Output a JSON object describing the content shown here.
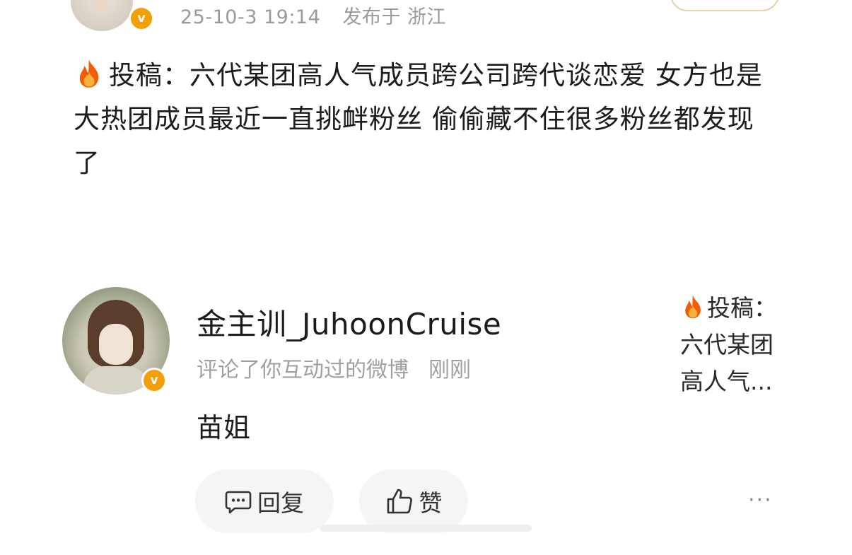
{
  "post": {
    "date": "25-10-3 19:14",
    "location": "发布于 浙江",
    "text": "投稿：六代某团高人气成员跨公司跨代谈恋爱 女方也是大热团成员最近一直挑衅粉丝 偷偷藏不住很多粉丝都发现了"
  },
  "notification": {
    "commenter_name": "金主训_JuhoonCruise",
    "action": "评论了你互动过的微博",
    "time": "刚刚",
    "comment": "苗姐",
    "quote_line1": "投稿：",
    "quote_line2": "六代某团",
    "quote_line3": "高人气..."
  },
  "actions": {
    "reply_label": "回复",
    "like_label": "赞",
    "more_label": "···"
  },
  "colors": {
    "verified_badge": "#f2a007",
    "meta_text": "#9a9a9a",
    "pill_bg": "#f5f5f5"
  },
  "icons": [
    "fire-icon",
    "verified-icon",
    "comment-icon",
    "thumbs-up-icon",
    "more-icon"
  ]
}
